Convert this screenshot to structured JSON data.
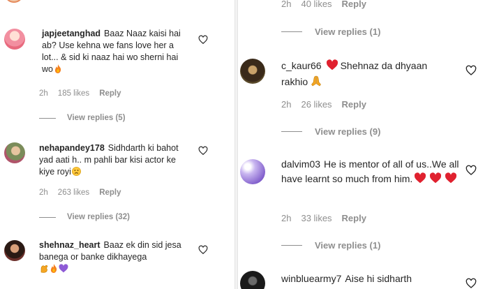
{
  "left": {
    "comments": [
      {
        "username": "japjeetanghad",
        "text": "Baaz Naaz kaisi hai ab? Use kehna we fans love her a lot... & sid ki naaz hai wo sherni hai wo",
        "emojis": [
          "fire"
        ],
        "time": "2h",
        "likes": "185 likes",
        "reply": "Reply",
        "view_replies": "View replies (5)"
      },
      {
        "username": "nehapandey178",
        "text": "Sidhdarth ki bahot yad aati h.. m pahli bar kisi actor ke kiye royi",
        "emojis": [
          "sad-face"
        ],
        "time": "2h",
        "likes": "263 likes",
        "reply": "Reply",
        "view_replies": "View replies (32)"
      },
      {
        "username": "shehnaz_heart",
        "text": "Baaz ek din sid jesa banega or banke dikhayega",
        "emojis": [
          "flexed-arm",
          "fire",
          "purple-heart"
        ],
        "time": "",
        "likes": "",
        "reply": "",
        "view_replies": ""
      }
    ]
  },
  "right": {
    "top_meta": {
      "time": "2h",
      "likes": "40 likes",
      "reply": "Reply"
    },
    "top_view_replies": "View replies (1)",
    "comments": [
      {
        "username": "c_kaur66",
        "text": "Shehnaz da dhyaan rakhio",
        "emojis": [
          "red-heart",
          "folded-hands"
        ],
        "time": "2h",
        "likes": "26 likes",
        "reply": "Reply",
        "view_replies": "View replies (9)"
      },
      {
        "username": "dalvim03",
        "text": "He is mentor of all of us..We all have learnt so much from him.",
        "emojis": [
          "red-heart",
          "red-heart",
          "red-heart"
        ],
        "time": "2h",
        "likes": "33 likes",
        "reply": "Reply",
        "view_replies": "View replies (1)"
      },
      {
        "username": "winbluearmy7",
        "text": "Aise hi sidharth",
        "emojis": [],
        "time": "",
        "likes": "",
        "reply": "",
        "view_replies": ""
      }
    ]
  },
  "colors": {
    "text": "#262626",
    "muted": "#8e8e8e",
    "heart_red": "#e0212f",
    "fire_orange": "#f58220",
    "purple": "#8e5bd6"
  }
}
